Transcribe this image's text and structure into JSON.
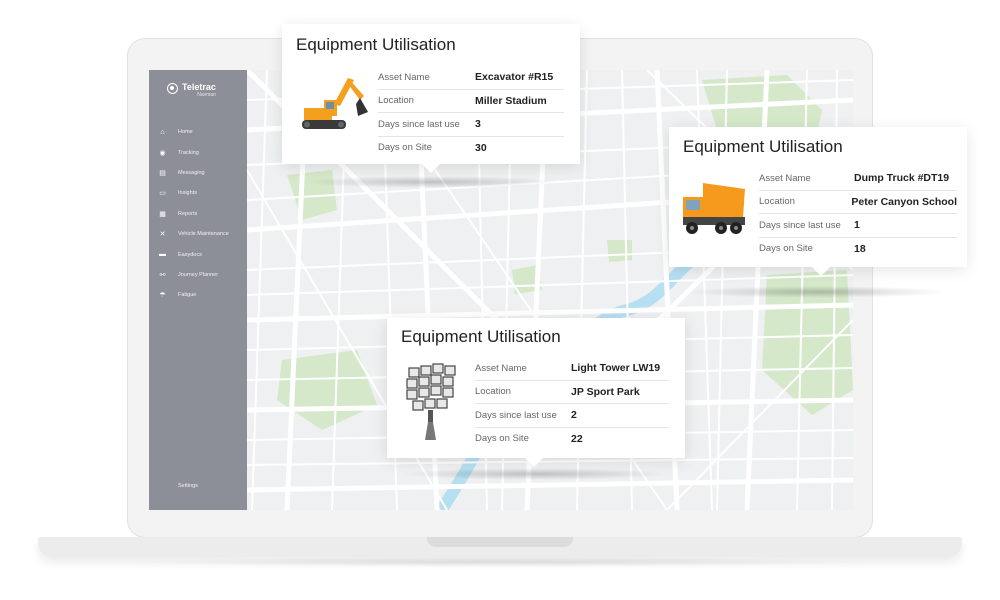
{
  "app": {
    "brand_name": "Teletrac",
    "brand_sub": "Navman"
  },
  "sidebar": {
    "items": [
      {
        "label": "Home",
        "icon": "home-icon"
      },
      {
        "label": "Tracking",
        "icon": "tracking-icon"
      },
      {
        "label": "Messaging",
        "icon": "messaging-icon"
      },
      {
        "label": "Insights",
        "icon": "insights-icon"
      },
      {
        "label": "Reports",
        "icon": "reports-icon"
      },
      {
        "label": "Vehicle Maintenance",
        "icon": "wrench-icon"
      },
      {
        "label": "Easydocs",
        "icon": "document-icon"
      },
      {
        "label": "Journey Planner",
        "icon": "route-icon"
      },
      {
        "label": "Fatigue",
        "icon": "fatigue-icon"
      }
    ],
    "settings_label": "Settings"
  },
  "cards": [
    {
      "title": "Equipment Utilisation",
      "asset_name_label": "Asset Name",
      "asset_name": "Excavator #R15",
      "location_label": "Location",
      "location": "Miller Stadium",
      "days_since_label": "Days since last use",
      "days_since": "3",
      "days_on_site_label": "Days on Site",
      "days_on_site": "30",
      "image": "excavator-icon"
    },
    {
      "title": "Equipment Utilisation",
      "asset_name_label": "Asset Name",
      "asset_name": "Dump Truck #DT19",
      "location_label": "Location",
      "location": "Peter Canyon School",
      "days_since_label": "Days since last use",
      "days_since": "1",
      "days_on_site_label": "Days on Site",
      "days_on_site": "18",
      "image": "dump-truck-icon"
    },
    {
      "title": "Equipment Utilisation",
      "asset_name_label": "Asset Name",
      "asset_name": "Light Tower LW19",
      "location_label": "Location",
      "location": "JP Sport Park",
      "days_since_label": "Days since last use",
      "days_since": "2",
      "days_on_site_label": "Days on Site",
      "days_on_site": "22",
      "image": "light-tower-icon"
    }
  ],
  "colors": {
    "sidebar": "#8c8f97",
    "map_bg": "#eef0f1",
    "park": "#d5e8c9",
    "river": "#b6dff2",
    "excavator": "#f2a01e",
    "truck_bed": "#f59a1c"
  }
}
